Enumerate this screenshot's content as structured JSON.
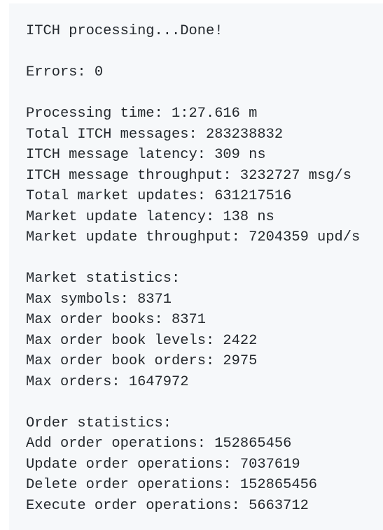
{
  "output": {
    "status_line": "ITCH processing...Done!",
    "errors_line": "Errors: 0",
    "processing_time": "Processing time: 1:27.616 m",
    "total_itch_messages": "Total ITCH messages: 283238832",
    "itch_message_latency": "ITCH message latency: 309 ns",
    "itch_message_throughput": "ITCH message throughput: 3232727 msg/s",
    "total_market_updates": "Total market updates: 631217516",
    "market_update_latency": "Market update latency: 138 ns",
    "market_update_throughput": "Market update throughput: 7204359 upd/s",
    "market_statistics_header": "Market statistics:",
    "max_symbols": "Max symbols: 8371",
    "max_order_books": "Max order books: 8371",
    "max_order_book_levels": "Max order book levels: 2422",
    "max_order_book_orders": "Max order book orders: 2975",
    "max_orders": "Max orders: 1647972",
    "order_statistics_header": "Order statistics:",
    "add_order_operations": "Add order operations: 152865456",
    "update_order_operations": "Update order operations: 7037619",
    "delete_order_operations": "Delete order operations: 152865456",
    "execute_order_operations": "Execute order operations: 5663712"
  },
  "colors": {
    "background": "#f6f8fa",
    "text": "#24292e"
  }
}
